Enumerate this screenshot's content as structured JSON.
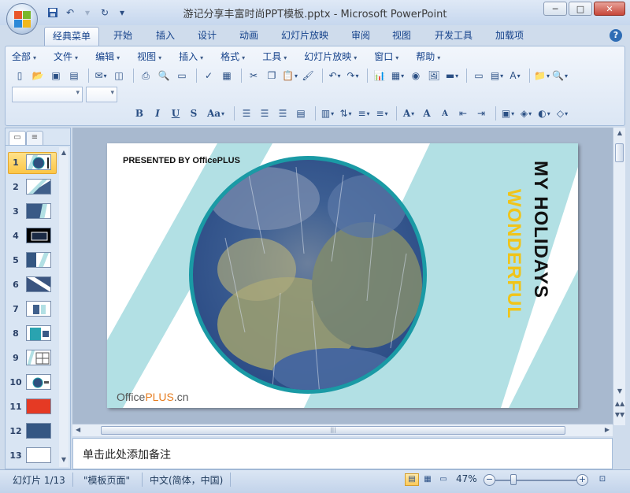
{
  "window": {
    "title": "游记分享丰富时尚PPT模板.pptx - Microsoft PowerPoint",
    "minimize": "─",
    "maximize": "□",
    "close": "✕"
  },
  "quick_access": {
    "save_icon": "save-icon",
    "undo_icon": "undo-icon",
    "redo_icon": "redo-icon",
    "customize": "▾"
  },
  "tabs": [
    {
      "label": "经典菜单",
      "active": true
    },
    {
      "label": "开始"
    },
    {
      "label": "插入"
    },
    {
      "label": "设计"
    },
    {
      "label": "动画"
    },
    {
      "label": "幻灯片放映"
    },
    {
      "label": "审阅"
    },
    {
      "label": "视图"
    },
    {
      "label": "开发工具"
    },
    {
      "label": "加载项"
    }
  ],
  "help": "?",
  "menu": [
    "全部",
    "文件",
    "编辑",
    "视图",
    "插入",
    "格式",
    "工具",
    "幻灯片放映",
    "窗口",
    "帮助"
  ],
  "formatting": {
    "bold": "B",
    "italic": "I",
    "underline": "U",
    "shadow": "S",
    "change_case": "Aa",
    "font_color": "A",
    "grow": "A",
    "shrink": "A"
  },
  "panel_tabs": [
    "slides-tab",
    "outline-tab"
  ],
  "thumbnails": [
    {
      "num": "1",
      "selected": true
    },
    {
      "num": "2"
    },
    {
      "num": "3"
    },
    {
      "num": "4"
    },
    {
      "num": "5"
    },
    {
      "num": "6"
    },
    {
      "num": "7"
    },
    {
      "num": "8"
    },
    {
      "num": "9"
    },
    {
      "num": "10"
    },
    {
      "num": "11"
    },
    {
      "num": "12"
    },
    {
      "num": "13"
    }
  ],
  "slide": {
    "presented": "PRESENTED BY OfficePLUS",
    "title_line1": "MY HOLIDAYS",
    "title_line2": "WONDERFUL",
    "logo_office": "Office",
    "logo_plus": "PLUS",
    "logo_cn": ".cn",
    "colors": {
      "stripe": "#b2e0e4",
      "ring": "#1a9aa5",
      "accent": "#f0c419"
    }
  },
  "notes": {
    "placeholder": "单击此处添加备注"
  },
  "status": {
    "slide_info": "幻灯片 1/13",
    "theme": "\"模板页面\"",
    "language": "中文(简体，中国)",
    "zoom": "47%",
    "zoom_out": "−",
    "zoom_in": "+"
  }
}
